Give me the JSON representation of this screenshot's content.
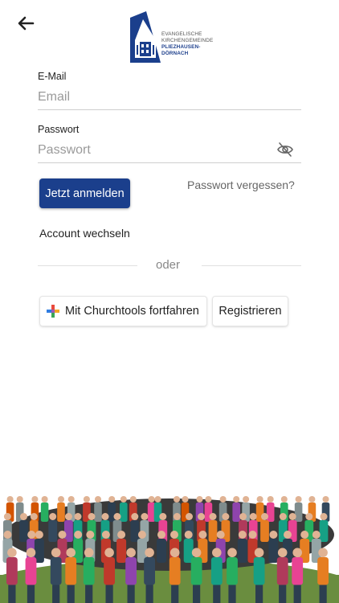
{
  "header": {
    "back_icon": "arrow-left-icon",
    "logo": {
      "icon": "church-logo-icon",
      "line1": "EVANGELISCHE",
      "line2": "KIRCHENGEMEINDE",
      "line3": "PLIEZHAUSEN-",
      "line4": "DÖRNACH",
      "brand_color": "#1b3f8c"
    }
  },
  "form": {
    "email_label": "E-Mail",
    "email_placeholder": "Email",
    "email_value": "",
    "password_label": "Passwort",
    "password_placeholder": "Passwort",
    "password_value": "",
    "visibility_icon": "eye-off-icon",
    "submit_label": "Jetzt anmelden",
    "forgot_label": "Passwort vergessen?",
    "switch_account_label": "Account wechseln"
  },
  "separator": {
    "label": "oder"
  },
  "alt_actions": {
    "churchtools_icon": "churchtools-cross-icon",
    "churchtools_label": "Mit Churchtools fortfahren",
    "register_label": "Registrieren"
  },
  "footer": {
    "image": "congregation-group-photo"
  },
  "colors": {
    "primary": "#1b3f8c",
    "grass": "#6a8d3f"
  }
}
